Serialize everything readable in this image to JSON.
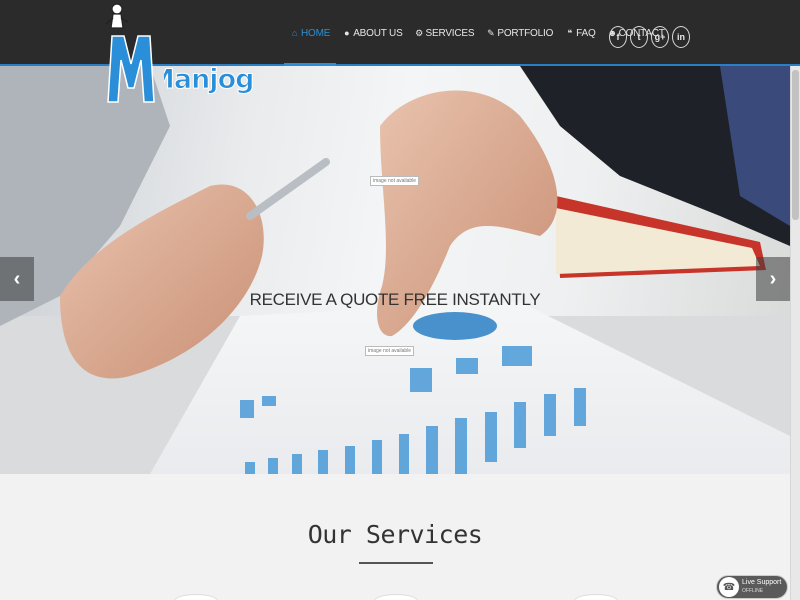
{
  "logo": {
    "text": "Manjog",
    "icon": "person-mascot-icon"
  },
  "nav": {
    "items": [
      {
        "label": "HOME",
        "icon": "home-icon",
        "glyph": "⌂",
        "active": true
      },
      {
        "label": "ABOUT US",
        "icon": "user-icon",
        "glyph": "●",
        "active": false
      },
      {
        "label": "SERVICES",
        "icon": "gears-icon",
        "glyph": "⚙",
        "active": false
      },
      {
        "label": "PORTFOLIO",
        "icon": "pencil-icon",
        "glyph": "✎",
        "active": false
      },
      {
        "label": "FAQ",
        "icon": "comments-icon",
        "glyph": "❝",
        "active": false
      },
      {
        "label": "CONTACT",
        "icon": "users-icon",
        "glyph": "☻",
        "active": false
      }
    ]
  },
  "social": [
    {
      "glyph": "f",
      "icon": "facebook-icon"
    },
    {
      "glyph": "t",
      "icon": "twitter-icon"
    },
    {
      "glyph": "g+",
      "icon": "google-plus-icon"
    },
    {
      "glyph": "in",
      "icon": "linkedin-icon"
    }
  ],
  "hero": {
    "caption": "RECEIVE A QUOTE FREE INSTANTLY",
    "prev_glyph": "‹",
    "next_glyph": "›",
    "broken_alt_1": "image not available",
    "broken_alt_2": "image not available"
  },
  "services": {
    "title": "Our Services"
  },
  "live_support": {
    "label": "Live Support",
    "status": "OFFLINE"
  },
  "colors": {
    "accent": "#2a8fd8",
    "header_bg": "#2b2b2b"
  }
}
